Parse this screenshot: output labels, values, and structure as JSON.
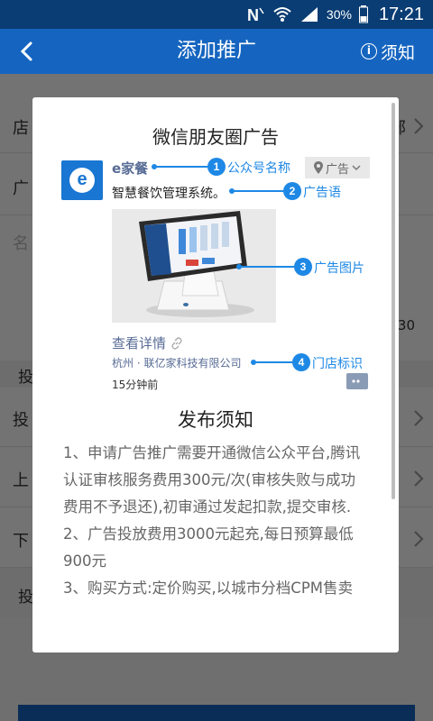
{
  "status_bar": {
    "battery": "30%",
    "time": "17:21"
  },
  "header": {
    "title": "添加推广",
    "notice_label": "须知"
  },
  "background": {
    "row1_label": "店",
    "row1_value": "部",
    "row2_label": "广",
    "row3_label": "名",
    "row3_value": "30",
    "section1": "投",
    "row4_label": "投",
    "row5_label": "上",
    "row6_label": "下",
    "section2": "投"
  },
  "dialog": {
    "title": "微信朋友圈广告",
    "ad": {
      "logo_letter": "e",
      "name": "e家餐",
      "tag": "广告",
      "description": "智慧餐饮管理系统。",
      "link": "查看详情",
      "store": "杭州 · 联亿家科技有限公司",
      "time": "15分钟前"
    },
    "annotations": [
      {
        "num": "1",
        "label": "公众号名称"
      },
      {
        "num": "2",
        "label": "广告语"
      },
      {
        "num": "3",
        "label": "广告图片"
      },
      {
        "num": "4",
        "label": "门店标识"
      }
    ],
    "notice_title": "发布须知",
    "notice_items": [
      "1、申请广告推广需要开通微信公众平台,腾讯认证审核服务费用300元/次(审核失败与成功费用不予退还),初审通过发起扣款,提交审核.",
      "2、广告投放费用3000元起充,每日预算最低900元",
      "3、购买方式:定价购买,以城市分档CPM售卖"
    ]
  }
}
